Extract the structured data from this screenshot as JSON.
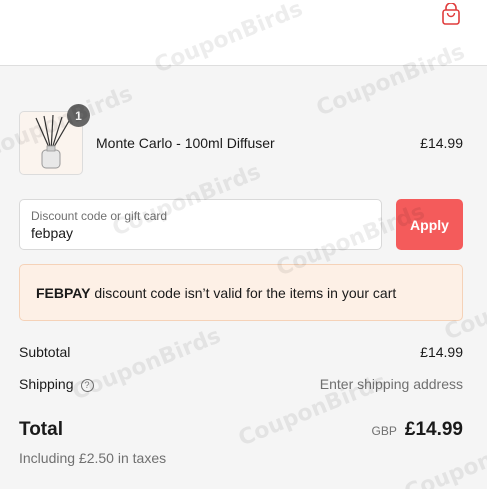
{
  "header": {
    "cart_icon": "shopping-bag-icon",
    "accent": "#f45b5b"
  },
  "line_item": {
    "quantity": "1",
    "name": "Monte Carlo - 100ml Diffuser",
    "price": "£14.99",
    "image": "reed-diffuser-bottle"
  },
  "discount": {
    "label": "Discount code or gift card",
    "value": "febpay",
    "apply_label": "Apply"
  },
  "notice": {
    "code": "FEBPAY",
    "message": " discount code isn’t valid for the items in your cart"
  },
  "summary": {
    "subtotal_label": "Subtotal",
    "subtotal_value": "£14.99",
    "shipping_label": "Shipping",
    "shipping_help_icon": "question-circle-icon",
    "shipping_value": "Enter shipping address",
    "total_label": "Total",
    "currency": "GBP",
    "total_value": "£14.99",
    "taxes_text": "Including £2.50 in taxes"
  },
  "watermark": "CouponBirds"
}
